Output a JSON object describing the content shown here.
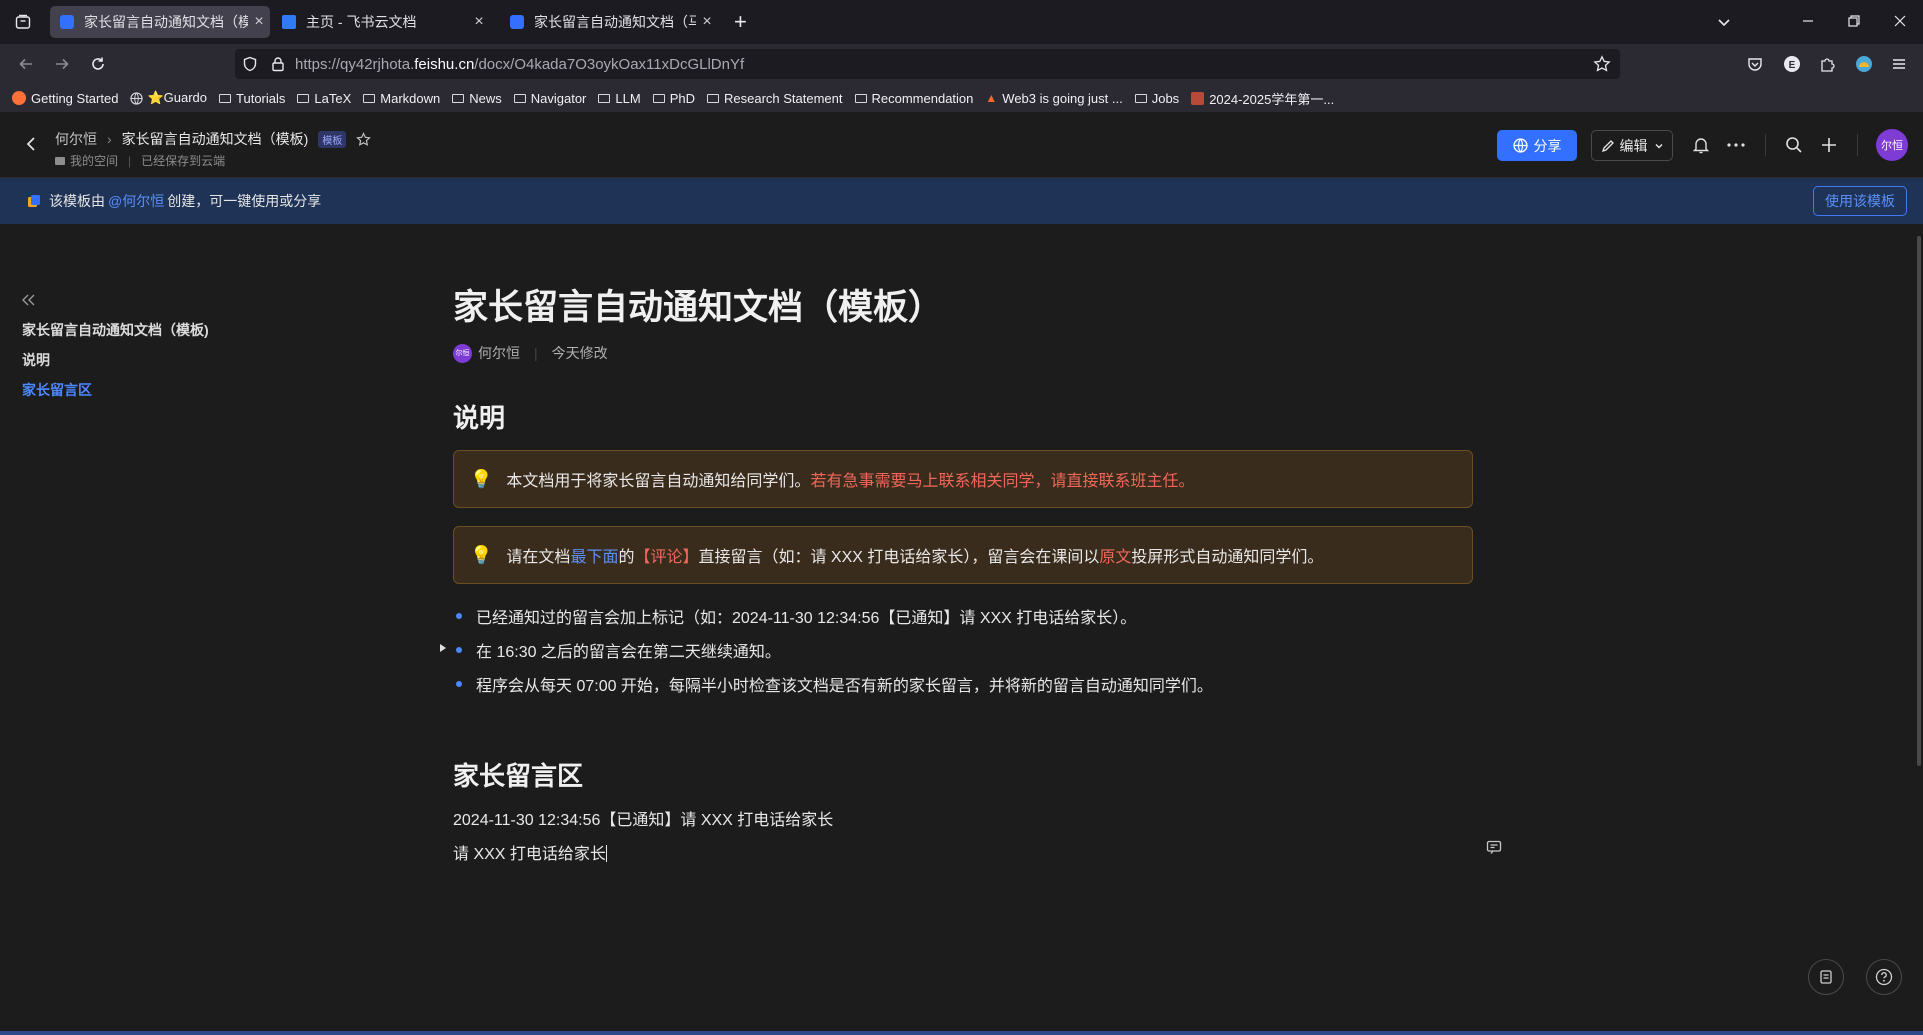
{
  "browser": {
    "tabs": [
      {
        "title": "家长留言自动通知文档（模板)",
        "active": true,
        "favicon_color": "#3370ff"
      },
      {
        "title": "主页 - 飞书云文档",
        "active": false,
        "favicon_color": "#2f7bf5"
      },
      {
        "title": "家长留言自动通知文档（马冬梅",
        "active": false,
        "favicon_color": "#3370ff"
      }
    ],
    "new_tab": "+",
    "url_prefix": "https://qy42rjhota.",
    "url_domain": "feishu.cn",
    "url_path": "/docx/O4kada7O3oykOax11xDcGLlDnYf",
    "bookmarks": [
      "Getting Started",
      "⭐Guardo",
      "Tutorials",
      "LaTeX",
      "Markdown",
      "News",
      "Navigator",
      "LLM",
      "PhD",
      "Research Statement",
      "Recommendation",
      "Web3 is going just ...",
      "Jobs",
      "2024-2025学年第一..."
    ]
  },
  "header": {
    "space": "何尔恒",
    "doc_name": "家长留言自动通知文档（模板)",
    "template_tag": "模板",
    "my_space": "我的空间",
    "save_status": "已经保存到云端",
    "share_label": "分享",
    "edit_label": "编辑",
    "avatar_text": "尔恒"
  },
  "banner": {
    "prefix": "该模板由",
    "mention": "@何尔恒",
    "suffix": "创建，可一键使用或分享",
    "use_button": "使用该模板"
  },
  "outline": {
    "items": [
      {
        "label": "家长留言自动通知文档（模板)"
      },
      {
        "label": "说明"
      },
      {
        "label": "家长留言区"
      }
    ]
  },
  "doc": {
    "title": "家长留言自动通知文档（模板）",
    "author": "何尔恒",
    "author_avatar": "尔恒",
    "modified": "今天修改",
    "section1": "说明",
    "callout1_a": "本文档用于将家长留言自动通知给同学们。",
    "callout1_b": "若有急事需要马上联系相关同学，请直接联系班主任。",
    "callout2_a": "请在文档",
    "callout2_b": "最下面",
    "callout2_c": "的",
    "callout2_d": "【评论】",
    "callout2_e": "直接留言（如：请 XXX 打电话给家长），留言会在课间以",
    "callout2_f": "原文",
    "callout2_g": "投屏形式自动通知同学们。",
    "bullets": [
      "已经通知过的留言会加上标记（如：2024-11-30 12:34:56【已通知】请 XXX 打电话给家长）。",
      "在 16:30 之后的留言会在第二天继续通知。",
      "程序会从每天 07:00 开始，每隔半小时检查该文档是否有新的家长留言，并将新的留言自动通知同学们。"
    ],
    "section2": "家长留言区",
    "line1": "2024-11-30 12:34:56【已通知】请 XXX 打电话给家长",
    "line2": "请 XXX 打电话给家长"
  }
}
